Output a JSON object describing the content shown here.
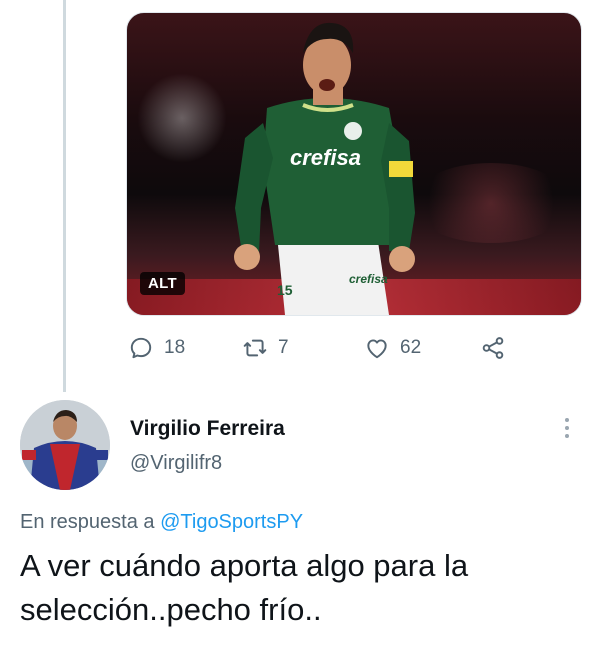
{
  "media": {
    "alt_badge": "ALT",
    "jersey_text": "crefisa",
    "shorts_text": "crefisa",
    "shorts_number": "15"
  },
  "actions": {
    "reply_count": "18",
    "retweet_count": "7",
    "like_count": "62"
  },
  "reply": {
    "display_name": "Virgilio Ferreira",
    "handle": "@Virgilifr8",
    "replying_to_prefix": "En respuesta a",
    "replying_to_mention": "@TigoSportsPY",
    "text": "A ver cuándo aporta algo para la selección..pecho frío.."
  },
  "colors": {
    "accent": "#1d9bf0",
    "secondary_text": "#536471",
    "thread_line": "#cfd9de"
  },
  "icons": [
    "reply-icon",
    "retweet-icon",
    "like-icon",
    "share-icon",
    "more-options-icon"
  ]
}
